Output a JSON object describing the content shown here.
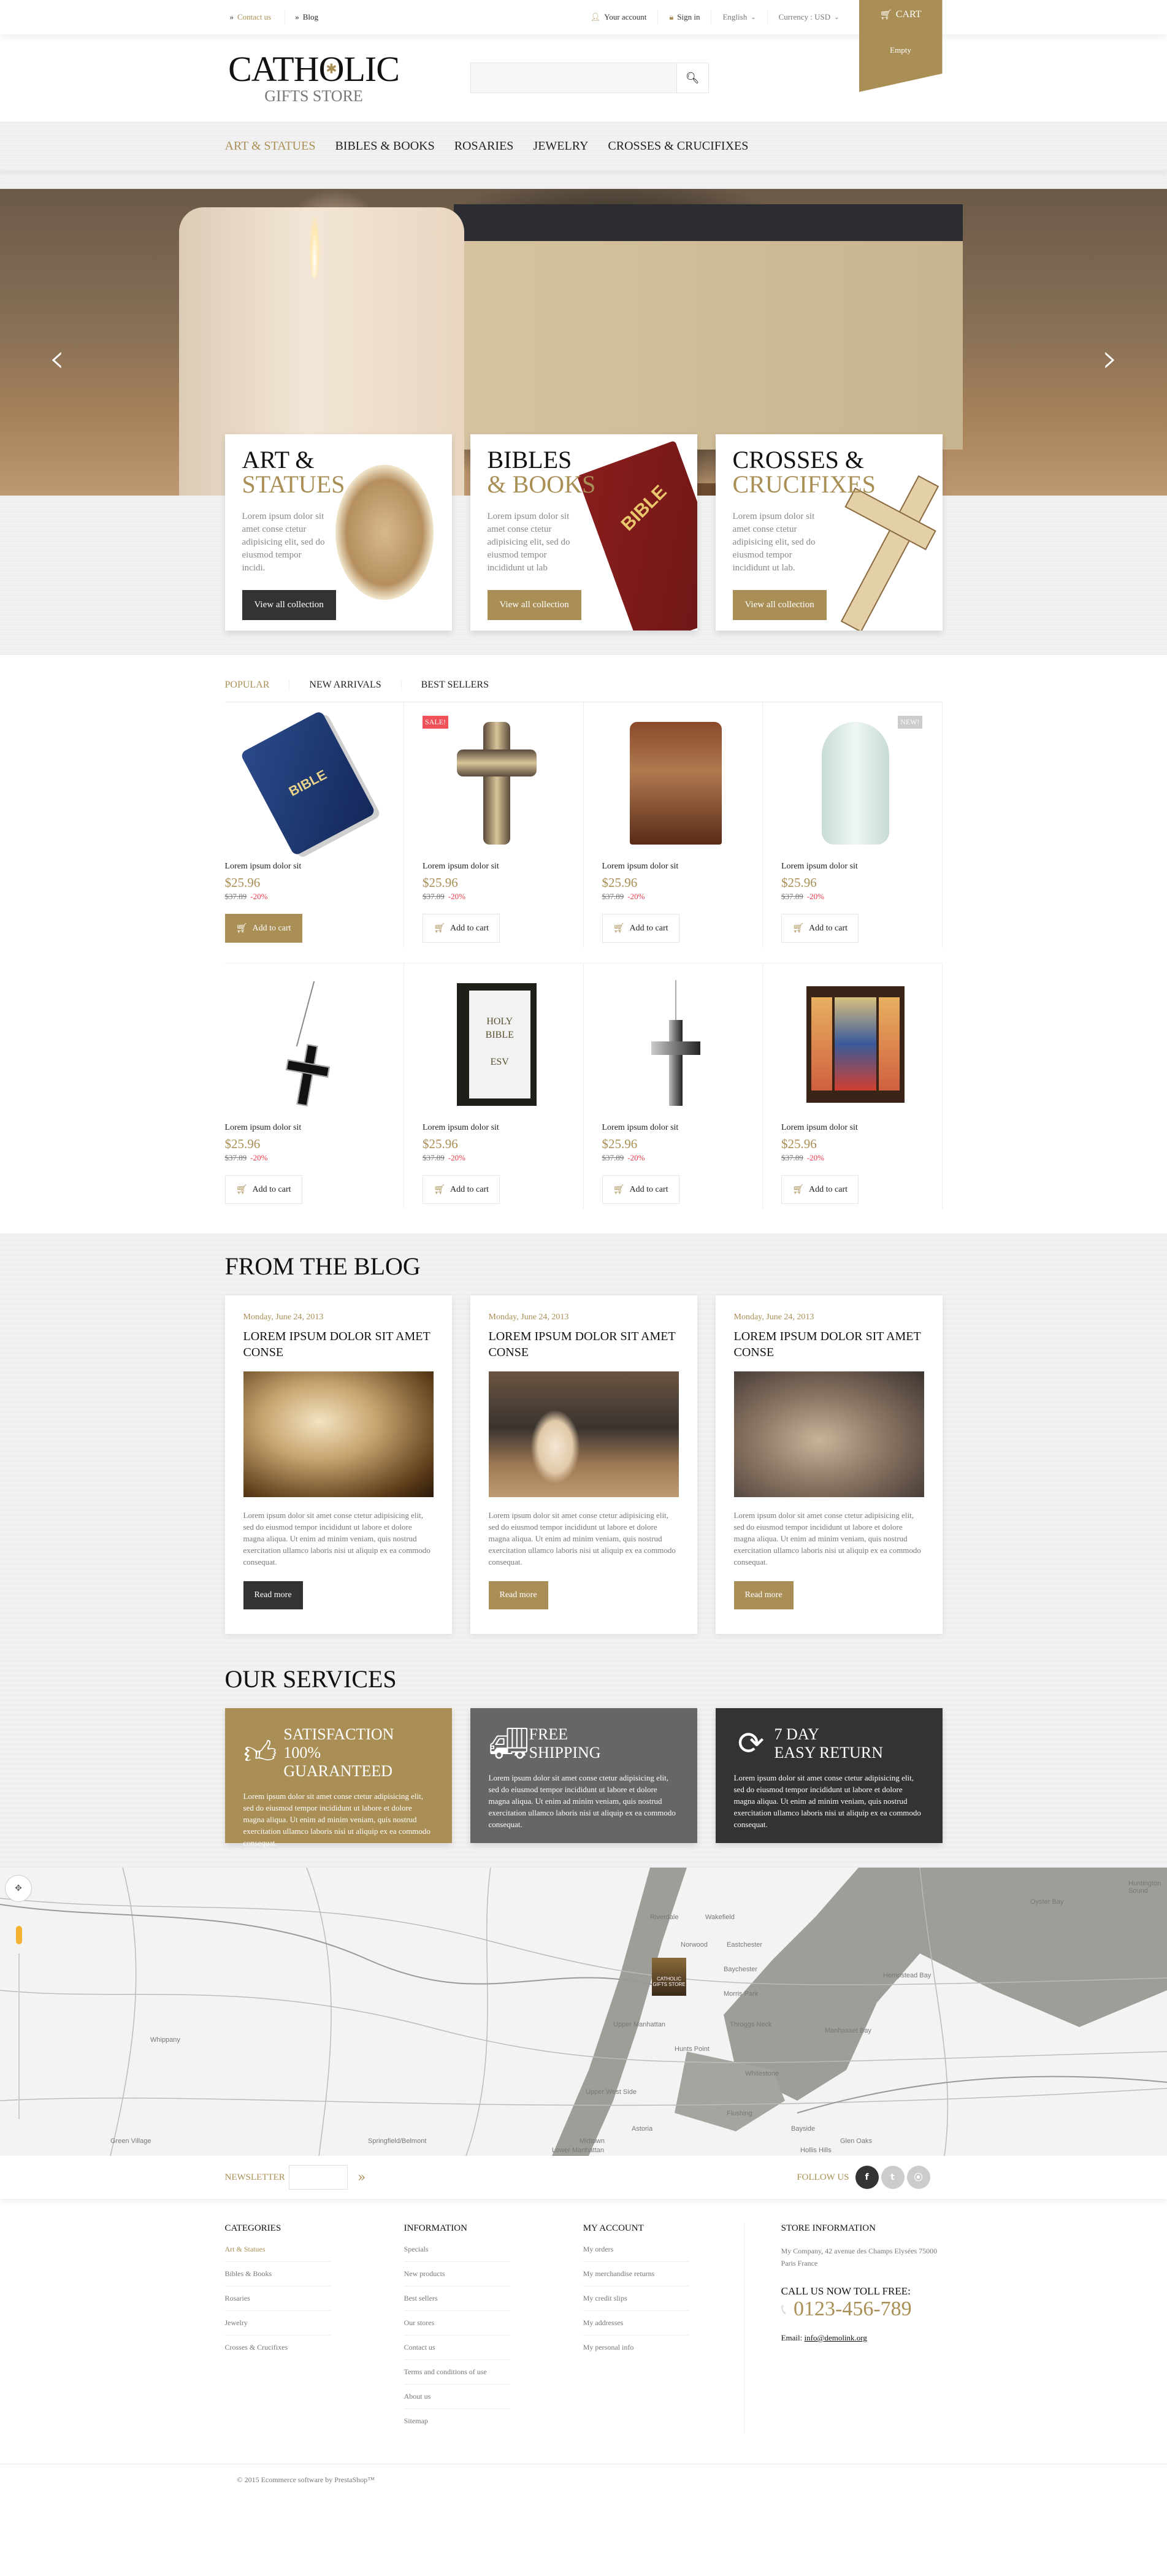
{
  "colors": {
    "accent": "#a98f55",
    "dark": "#333333",
    "mid_gray": "#666666",
    "sale_red": "#f05058",
    "discount_red": "#e8394a"
  },
  "topbar": {
    "contact": "Contact us",
    "blog": "Blog",
    "account": "Your account",
    "signin": "Sign in",
    "language": "English",
    "currency": "Currency : USD",
    "cart_label": "CART",
    "cart_status": "Empty"
  },
  "header": {
    "logo_line1": "CATHOLIC",
    "logo_line2": "GIFTS STORE",
    "search_placeholder": ""
  },
  "nav": {
    "items": [
      {
        "label": "ART & STATUES",
        "active": true
      },
      {
        "label": "BIBLES & BOOKS"
      },
      {
        "label": "ROSARIES"
      },
      {
        "label": "JEWELRY"
      },
      {
        "label": "CROSSES & CRUCIFIXES"
      }
    ]
  },
  "hero": {
    "prev_icon": "chevron-left",
    "next_icon": "chevron-right"
  },
  "banners": [
    {
      "title": "ART &",
      "subtitle": "STATUES",
      "text": "Lorem ipsum dolor sit amet conse ctetur adipisicing elit, sed do eiusmod tempor incidi.",
      "button": "View all collection"
    },
    {
      "title": "BIBLES",
      "subtitle": "& BOOKS",
      "text": "Lorem ipsum dolor sit amet conse ctetur adipisicing elit, sed do eiusmod tempor incididunt ut lab",
      "button": "View all collection"
    },
    {
      "title": "CROSSES &",
      "subtitle": "CRUCIFIXES",
      "text": "Lorem ipsum dolor sit amet conse ctetur adipisicing elit, sed do eiusmod tempor incididunt ut lab.",
      "button": "View all collection"
    }
  ],
  "product_tabs": [
    {
      "label": "POPULAR",
      "active": true
    },
    {
      "label": "NEW ARRIVALS"
    },
    {
      "label": "BEST SELLERS"
    }
  ],
  "products": [
    {
      "name": "Lorem ipsum dolor sit",
      "price": "$25.96",
      "old_price": "$37.89",
      "discount": "-20%",
      "button": "Add to cart",
      "badge": "",
      "image": "blue-bible"
    },
    {
      "name": "Lorem ipsum dolor sit",
      "price": "$25.96",
      "old_price": "$37.89",
      "discount": "-20%",
      "button": "Add to cart",
      "badge": "SALE!",
      "image": "ornate-cross"
    },
    {
      "name": "Lorem ipsum dolor sit",
      "price": "$25.96",
      "old_price": "$37.89",
      "discount": "-20%",
      "button": "Add to cart",
      "badge": "",
      "image": "music-box"
    },
    {
      "name": "Lorem ipsum dolor sit",
      "price": "$25.96",
      "old_price": "$37.89",
      "discount": "-20%",
      "button": "Add to cart",
      "badge": "NEW!",
      "image": "urn"
    },
    {
      "name": "Lorem ipsum dolor sit",
      "price": "$25.96",
      "old_price": "$37.89",
      "discount": "-20%",
      "button": "Add to cart",
      "badge": "",
      "image": "black-cross-necklace"
    },
    {
      "name": "Lorem ipsum dolor sit",
      "price": "$25.96",
      "old_price": "$37.89",
      "discount": "-20%",
      "button": "Add to cart",
      "badge": "",
      "image": "holy-bible-esv"
    },
    {
      "name": "Lorem ipsum dolor sit",
      "price": "$25.96",
      "old_price": "$37.89",
      "discount": "-20%",
      "button": "Add to cart",
      "badge": "",
      "image": "silver-cross-necklace"
    },
    {
      "name": "Lorem ipsum dolor sit",
      "price": "$25.96",
      "old_price": "$37.89",
      "discount": "-20%",
      "button": "Add to cart",
      "badge": "",
      "image": "icon-triptych"
    }
  ],
  "blog": {
    "title": "FROM THE BLOG",
    "posts": [
      {
        "date": "Monday, June 24, 2013",
        "title": "LOREM IPSUM DOLOR SIT AMET CONSE",
        "text": "Lorem ipsum dolor sit amet conse ctetur adipisicing elit, sed do eiusmod tempor incididunt ut labore et dolore magna aliqua. Ut enim ad minim veniam, quis nostrud exercitation ullamco laboris nisi ut aliquip ex ea commodo consequat.",
        "button": "Read more"
      },
      {
        "date": "Monday, June 24, 2013",
        "title": "LOREM IPSUM DOLOR SIT AMET CONSE",
        "text": "Lorem ipsum dolor sit amet conse ctetur adipisicing elit, sed do eiusmod tempor incididunt ut labore et dolore magna aliqua. Ut enim ad minim veniam, quis nostrud exercitation ullamco laboris nisi ut aliquip ex ea commodo consequat.",
        "button": "Read more"
      },
      {
        "date": "Monday, June 24, 2013",
        "title": "LOREM IPSUM DOLOR SIT AMET CONSE",
        "text": "Lorem ipsum dolor sit amet conse ctetur adipisicing elit, sed do eiusmod tempor incididunt ut labore et dolore magna aliqua. Ut enim ad minim veniam, quis nostrud exercitation ullamco laboris nisi ut aliquip ex ea commodo consequat.",
        "button": "Read more"
      }
    ]
  },
  "services": {
    "title": "OUR SERVICES",
    "items": [
      {
        "icon": "thumbs-up",
        "line1": "SATISFACTION",
        "line2": "100% GUARANTEED",
        "text": "Lorem ipsum dolor sit amet conse ctetur adipisicing elit, sed do eiusmod tempor incididunt ut labore et dolore magna aliqua. Ut enim ad minim veniam, quis nostrud exercitation ullamco laboris nisi ut aliquip ex ea commodo consequat."
      },
      {
        "icon": "truck",
        "line1": "FREE",
        "line2": "SHIPPING",
        "text": "Lorem ipsum dolor sit amet conse ctetur adipisicing elit, sed do eiusmod tempor incididunt ut labore et dolore magna aliqua. Ut enim ad minim veniam, quis nostrud exercitation ullamco laboris nisi ut aliquip ex ea commodo consequat."
      },
      {
        "icon": "refresh",
        "line1": "7 DAY",
        "line2": "EASY RETURN",
        "text": "Lorem ipsum dolor sit amet conse ctetur adipisicing elit, sed do eiusmod tempor incididunt ut labore et dolore magna aliqua. Ut enim ad minim veniam, quis nostrud exercitation ullamco laboris nisi ut aliquip ex ea commodo consequat."
      }
    ]
  },
  "map": {
    "marker_label": "CATHOLIC GIFTS STORE",
    "labels": [
      "Riverdale",
      "Wakefield",
      "Norwood",
      "Eastchester",
      "Baychester",
      "Morris Park",
      "Upper Manhattan",
      "Hunts Point",
      "Throggs Neck",
      "Whitestone",
      "Upper West Side",
      "Astoria",
      "Flushing",
      "Bayside",
      "Midtown",
      "Glen Oaks",
      "Hollis Hills",
      "Lower Manhattan",
      "Whippany",
      "Green Village",
      "Springfield/Belmont",
      "Oyster Bay",
      "Hempstead Bay",
      "Manhasset Bay",
      "Huntington Sound"
    ]
  },
  "newsletter": {
    "label": "NEWSLETTER",
    "placeholder": "",
    "follow_label": "FOLLOW US",
    "socials": [
      "facebook",
      "twitter",
      "rss"
    ]
  },
  "footer": {
    "categories": {
      "title": "CATEGORIES",
      "items": [
        "Art & Statues",
        "Bibles & Books",
        "Rosaries",
        "Jewelry",
        "Crosses & Crucifixes"
      ]
    },
    "information": {
      "title": "INFORMATION",
      "items": [
        "Specials",
        "New products",
        "Best sellers",
        "Our stores",
        "Contact us",
        "Terms and conditions of use",
        "About us",
        "Sitemap"
      ]
    },
    "account": {
      "title": "MY ACCOUNT",
      "items": [
        "My orders",
        "My merchandise returns",
        "My credit slips",
        "My addresses",
        "My personal info"
      ]
    },
    "store": {
      "title": "STORE INFORMATION",
      "address": "My Company, 42 avenue des Champs Elysées 75000 Paris France",
      "call_label": "CALL US NOW TOLL FREE:",
      "phone": "0123-456-789",
      "email_label": "Email:",
      "email": "info@demolink.org"
    },
    "copyright": "© 2015 Ecommerce software by PrestaShop™"
  }
}
